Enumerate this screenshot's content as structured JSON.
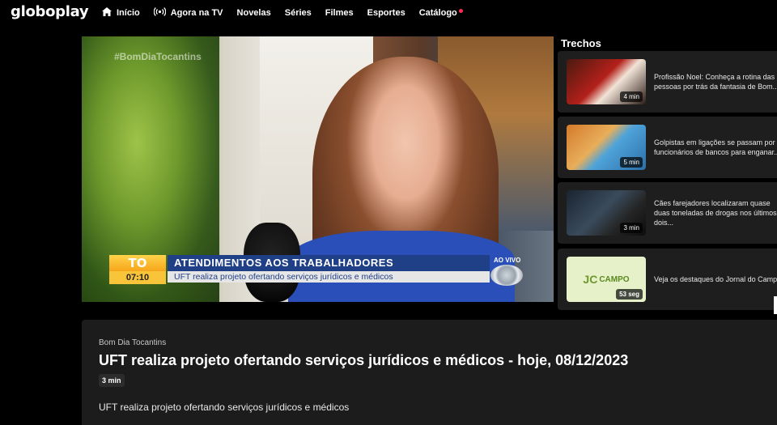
{
  "app": {
    "logo": "globoplay"
  },
  "nav": [
    {
      "label": "Início",
      "icon": "home-icon"
    },
    {
      "label": "Agora na TV",
      "icon": "broadcast-icon"
    },
    {
      "label": "Novelas"
    },
    {
      "label": "Séries"
    },
    {
      "label": "Filmes"
    },
    {
      "label": "Esportes"
    },
    {
      "label": "Catálogo",
      "badge_color": "#ff2d55"
    }
  ],
  "player": {
    "watermark": "#BomDiaTocantins",
    "badge_text": "TO",
    "time": "07:10",
    "headline": "ATENDIMENTOS AOS TRABALHADORES",
    "subline": "UFT realiza projeto ofertando serviços jurídicos e médicos",
    "live_label": "AO VIVO"
  },
  "sidebar": {
    "title": "Trechos",
    "items": [
      {
        "text": "Profissão Noel: Conheça a rotina das pessoas por trás da fantasia de Bom...",
        "duration": "4 min"
      },
      {
        "text": "Golpistas em ligações se passam por funcionários de bancos para enganar...",
        "duration": "5 min"
      },
      {
        "text": "Cães farejadores localizaram quase duas toneladas de drogas nos últimos dois...",
        "duration": "3 min"
      },
      {
        "text": "Veja os destaques do Jornal do Campo",
        "duration": "53 seg",
        "thumb_text": "JC",
        "thumb_sub": "CAMPO"
      }
    ]
  },
  "info": {
    "program": "Bom Dia Tocantins",
    "title": "UFT realiza projeto ofertando serviços jurídicos e médicos - hoje, 08/12/2023",
    "duration": "3 min",
    "description": "UFT realiza projeto ofertando serviços jurídicos e médicos"
  }
}
